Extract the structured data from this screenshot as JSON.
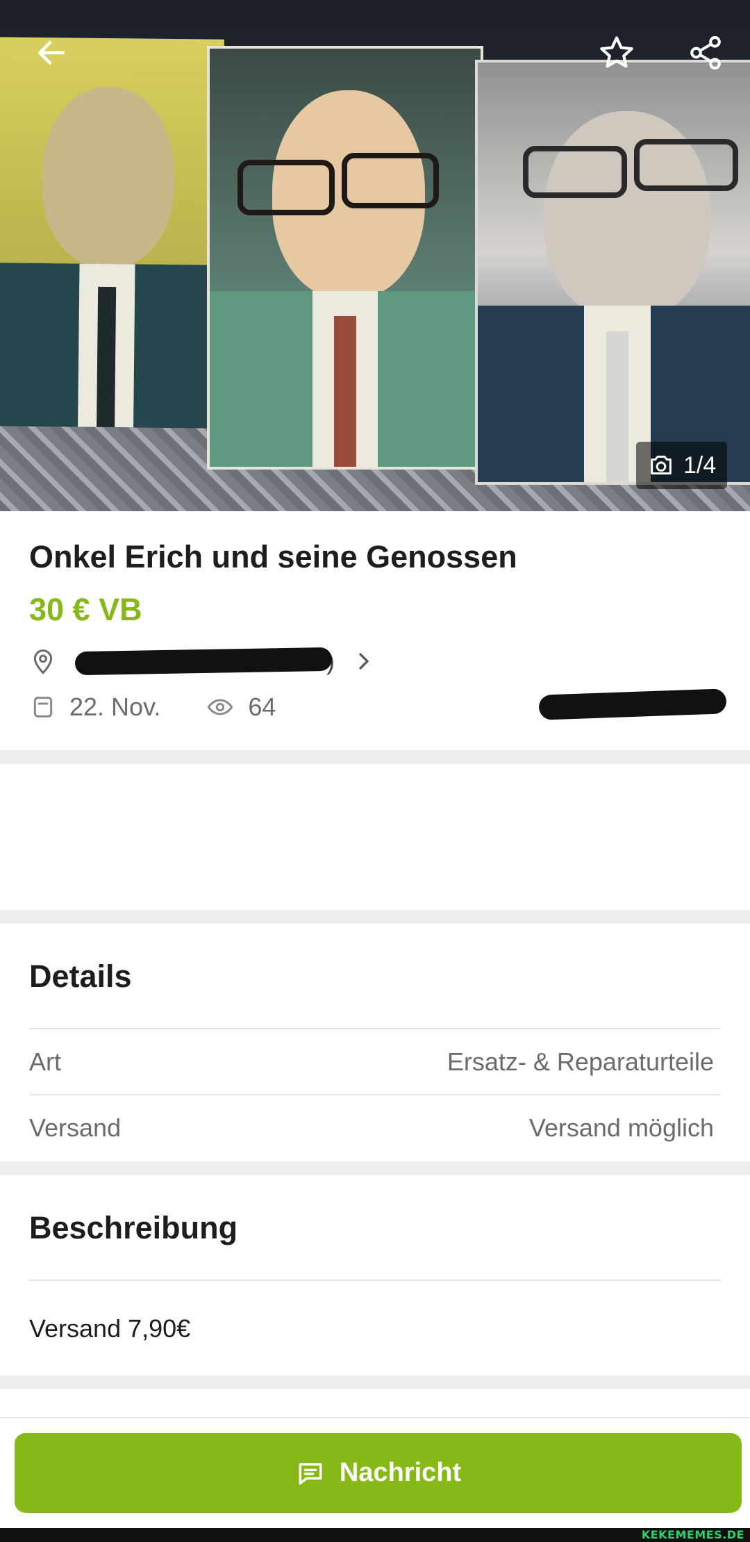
{
  "hero": {
    "image_counter": "1/4",
    "icons": {
      "back": "arrow-left-icon",
      "favorite": "star-outline-icon",
      "share": "share-icon",
      "camera": "camera-icon"
    }
  },
  "listing": {
    "title": "Onkel Erich und seine Genossen",
    "price": "30 € VB",
    "location_suffix": ")",
    "date": "22. Nov.",
    "views": "64"
  },
  "details": {
    "heading": "Details",
    "rows": [
      {
        "label": "Art",
        "value": "Ersatz- & Reparaturteile"
      },
      {
        "label": "Versand",
        "value": "Versand möglich"
      }
    ]
  },
  "description": {
    "heading": "Beschreibung",
    "text": "Versand 7,90€"
  },
  "action": {
    "message_label": "Nachricht"
  },
  "watermark": "KEKEMEMES.DE",
  "colors": {
    "accent": "#86b817",
    "text": "#1d1d1d",
    "muted": "#6b6b6b",
    "separator": "#efefef"
  }
}
